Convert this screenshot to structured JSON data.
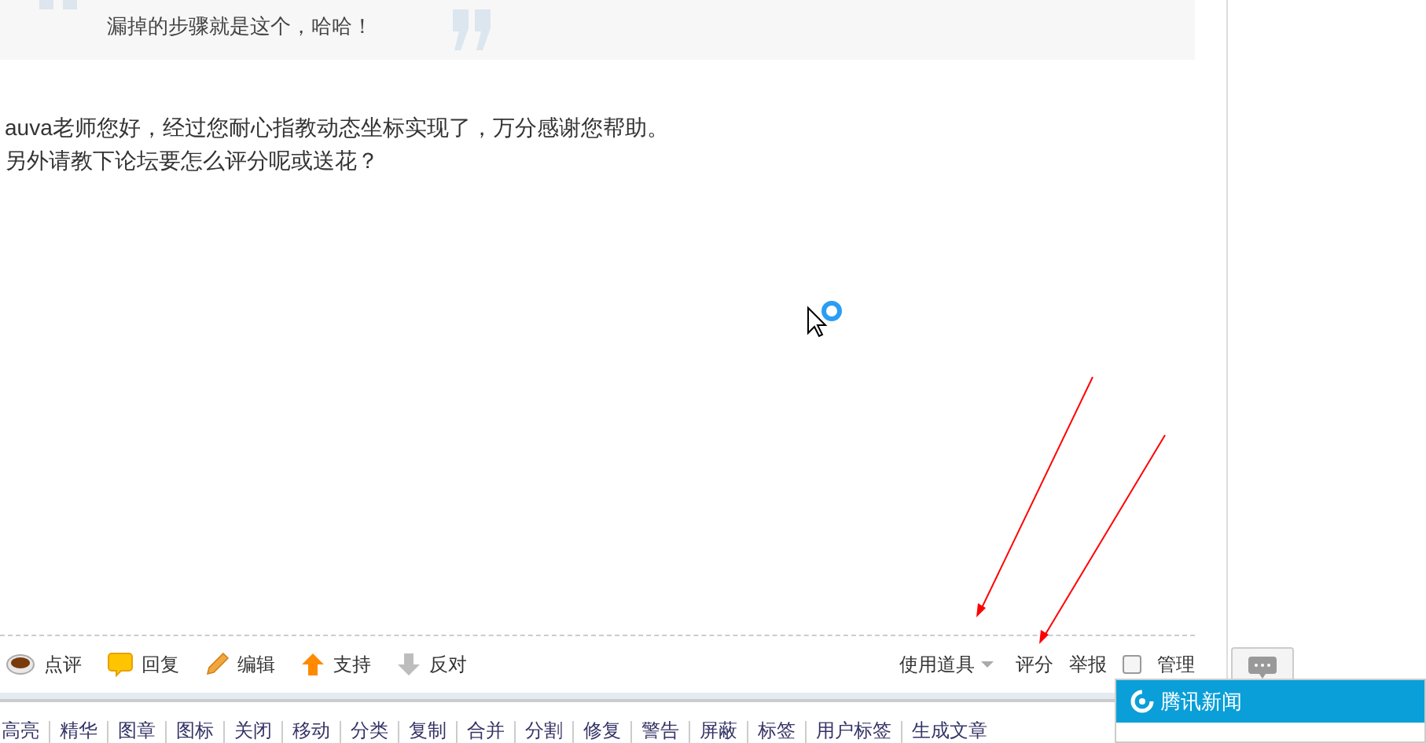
{
  "quote": {
    "text": "漏掉的步骤就是这个，哈哈！"
  },
  "message": [
    "auva老师您好，经过您耐心指教动态坐标实现了，万分感谢您帮助。",
    "另外请教下论坛要怎么评分呢或送花？"
  ],
  "actions": [
    {
      "kind": "comment",
      "label": "点评"
    },
    {
      "kind": "reply",
      "label": "回复"
    },
    {
      "kind": "edit",
      "label": "编辑"
    },
    {
      "kind": "support",
      "label": "支持"
    },
    {
      "kind": "oppose",
      "label": "反对"
    }
  ],
  "tools": {
    "label": "使用道具"
  },
  "rate": {
    "label": "评分"
  },
  "report": {
    "label": "举报"
  },
  "manage": {
    "label": "管理",
    "checked": false
  },
  "admin_links": [
    "高亮",
    "精华",
    "图章",
    "图标",
    "关闭",
    "移动",
    "分类",
    "复制",
    "合并",
    "分割",
    "修复",
    "警告",
    "屏蔽",
    "标签",
    "用户标签",
    "生成文章"
  ],
  "news_popup": {
    "title": "腾讯新闻"
  }
}
